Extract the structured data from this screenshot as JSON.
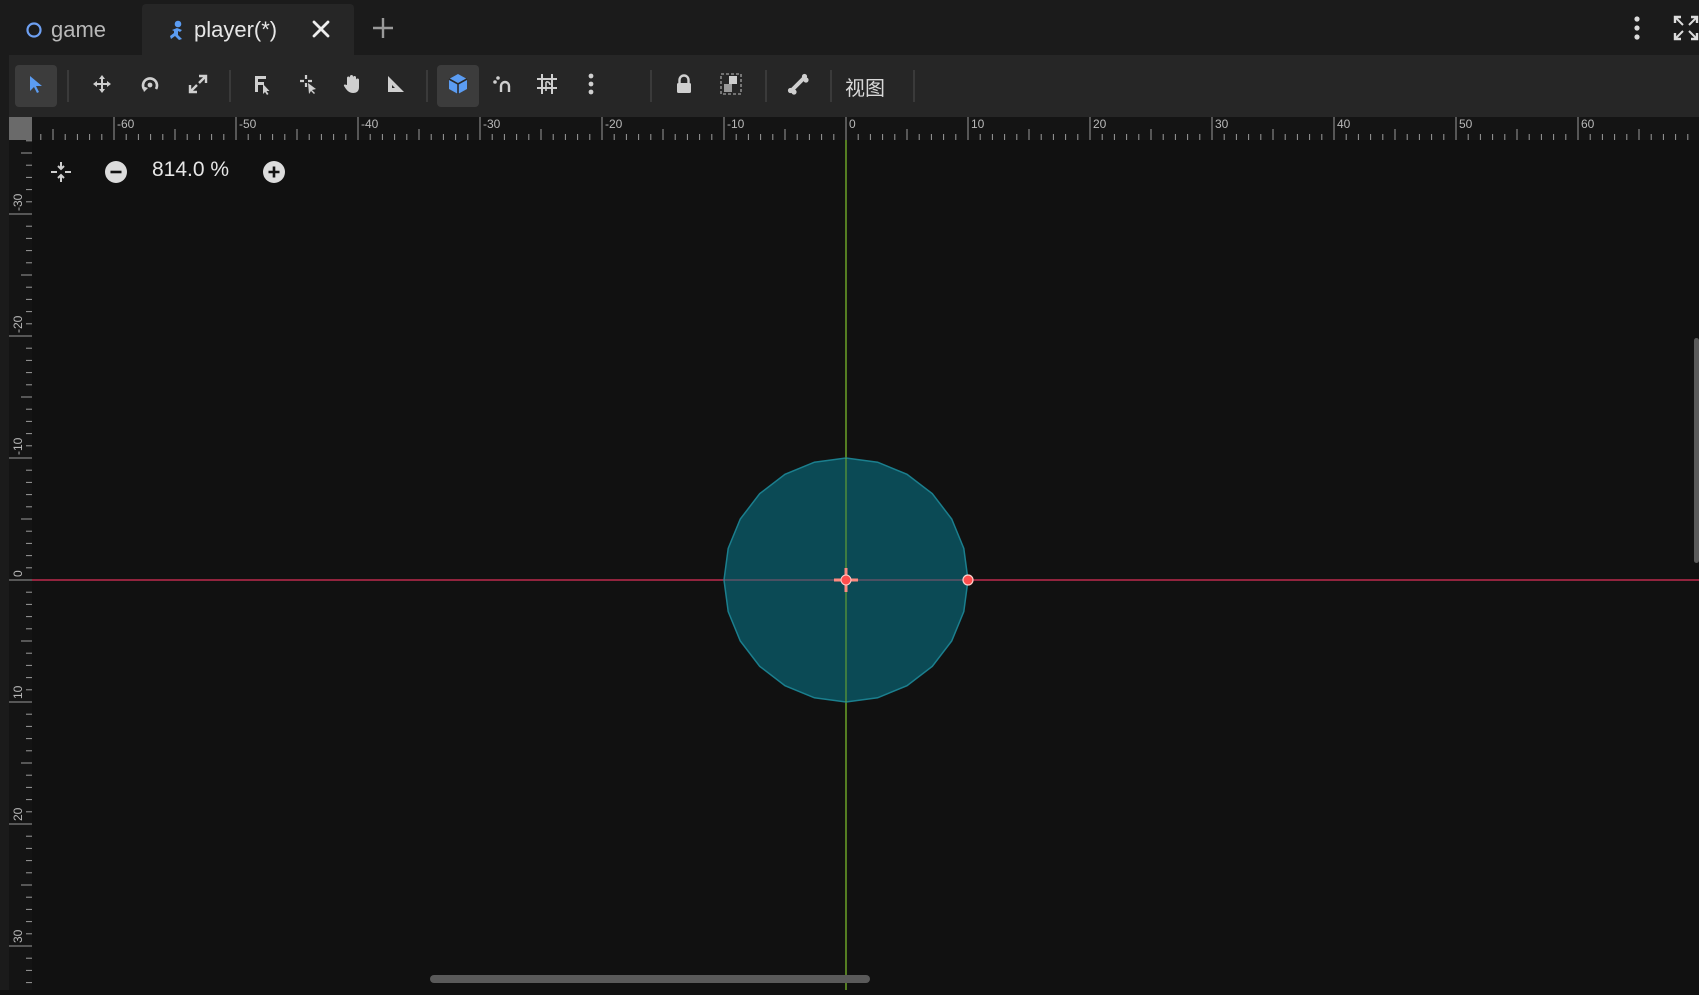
{
  "tabs": [
    {
      "label": "game",
      "icon": "circle-node-icon"
    },
    {
      "label": "player(*)",
      "icon": "character-body-icon",
      "active": true
    }
  ],
  "tab_actions": {
    "close_icon": "close-icon",
    "add_icon": "plus-icon",
    "menu_icon": "kebab-menu-icon",
    "fullscreen_icon": "distraction-free-icon"
  },
  "toolbar": {
    "tools": [
      "select-mode",
      "move-mode",
      "rotate-mode",
      "scale-mode",
      "selectable-nodes",
      "pivot-mode",
      "pan-mode",
      "ruler-mode",
      "smart-snap",
      "snap-to-points",
      "grid-snap",
      "snap-options",
      "lock",
      "group",
      "bone"
    ],
    "active_tools": [
      "select-mode",
      "smart-snap"
    ],
    "view_menu_label": "视图"
  },
  "zoom": {
    "level_label": "814.0 %"
  },
  "ruler_h_labels": [
    "-60",
    "-50",
    "-40",
    "-30",
    "-20",
    "-10",
    "0",
    "10",
    "20",
    "30",
    "40",
    "50",
    "60"
  ],
  "ruler_v_labels": [
    "-30",
    "-20",
    "-10",
    "0",
    "10",
    "20",
    "30"
  ],
  "shape": {
    "type": "CircleShape2D",
    "radius": 10,
    "fill": "#0b4a55",
    "outline": "#1b7f8e"
  },
  "colors": {
    "x_axis": "#e0315a",
    "y_axis": "#7ab82b",
    "accent": "#5b9cf2",
    "handle": "#ff4d4d"
  }
}
